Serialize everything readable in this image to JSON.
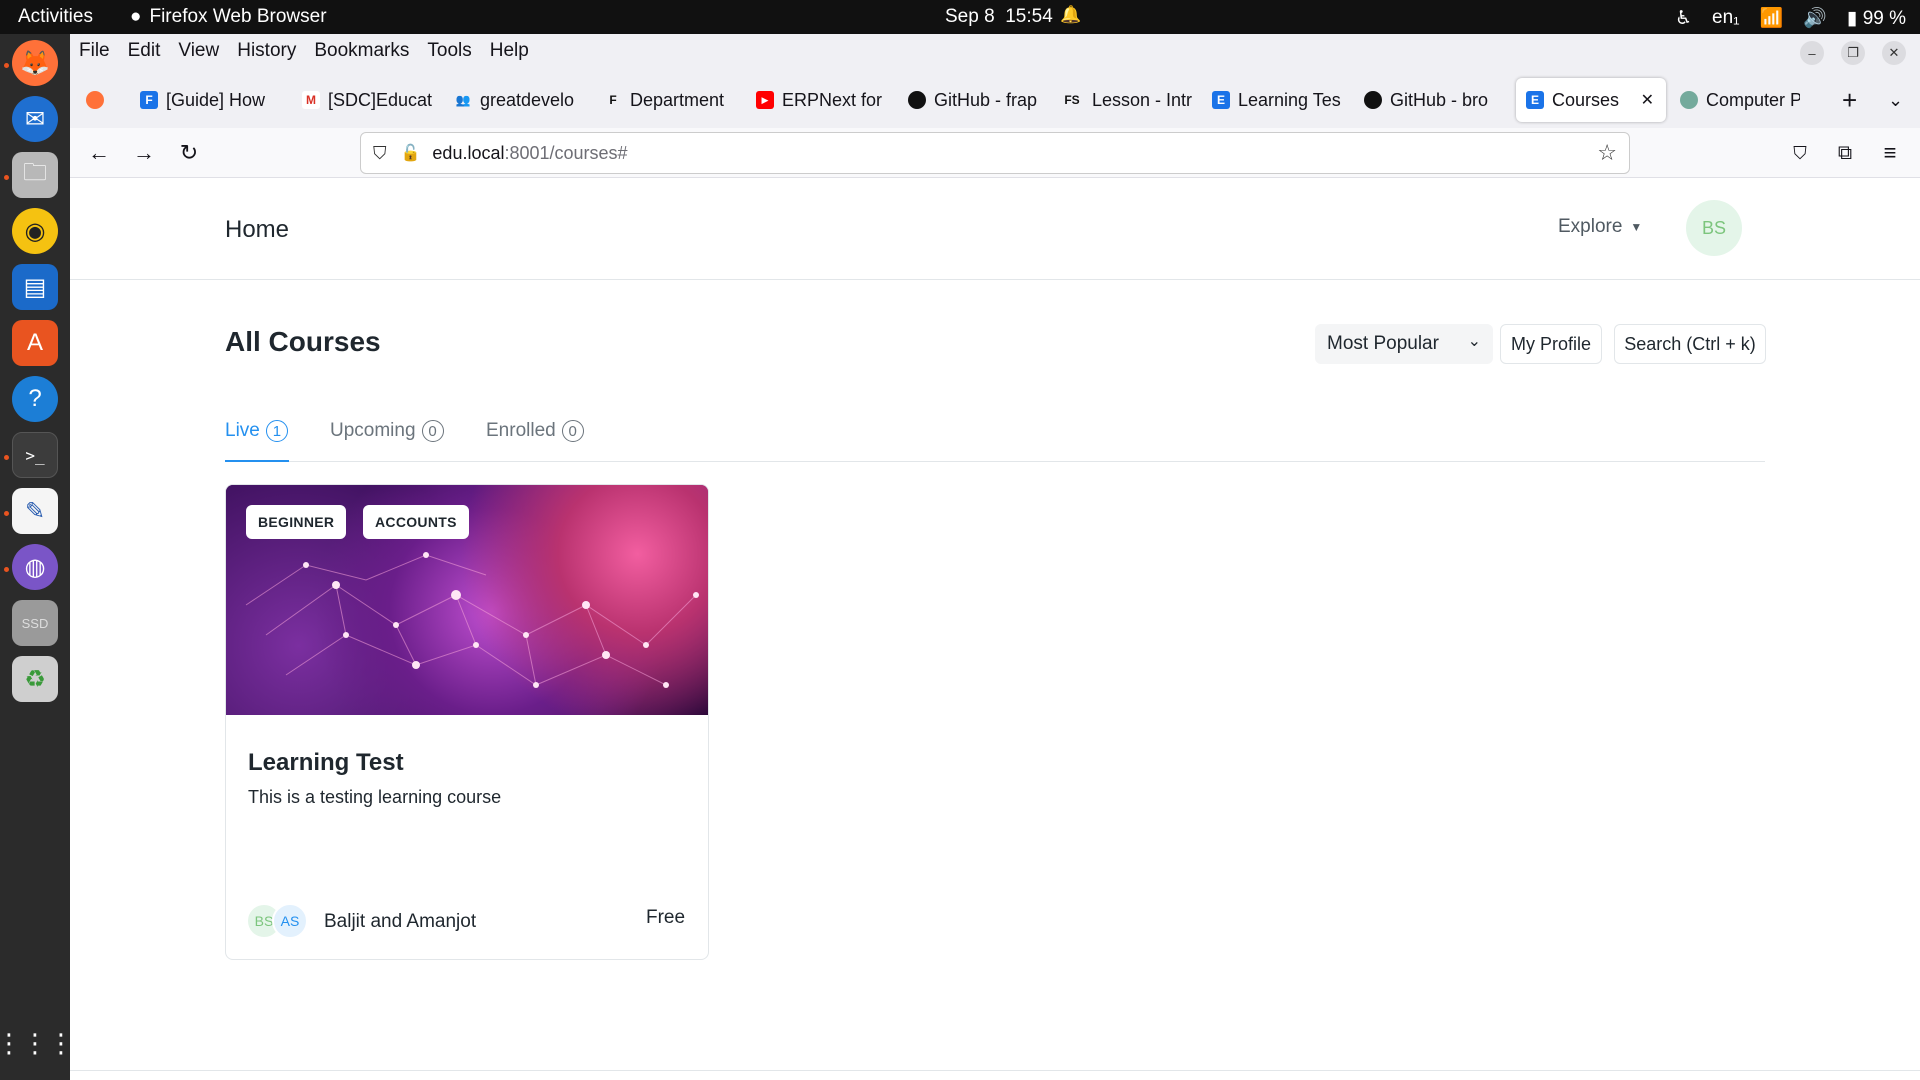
{
  "system_bar": {
    "activities": "Activities",
    "app_name": "Firefox Web Browser",
    "date": "Sep 8",
    "time": "15:54",
    "keyboard": "en₁",
    "battery": "99 %"
  },
  "menu": [
    "File",
    "Edit",
    "View",
    "History",
    "Bookmarks",
    "Tools",
    "Help"
  ],
  "tabs": [
    {
      "label": "[Guide] How",
      "favicon": "F",
      "color": "#1a73e8"
    },
    {
      "label": "[SDC]Educat",
      "favicon": "M",
      "color": "#d93025"
    },
    {
      "label": "greatdevelo",
      "favicon": "👥",
      "color": "#5f63d6"
    },
    {
      "label": "Department",
      "favicon": "F",
      "color": "#111111"
    },
    {
      "label": "ERPNext for",
      "favicon": "▶",
      "color": "#ff0000"
    },
    {
      "label": "GitHub - frap",
      "favicon": "●",
      "color": "#111111"
    },
    {
      "label": "Lesson - Intr",
      "favicon": "FS",
      "color": "#111111"
    },
    {
      "label": "Learning Tes",
      "favicon": "E",
      "color": "#1a73e8"
    },
    {
      "label": "GitHub - bro",
      "favicon": "●",
      "color": "#111111"
    },
    {
      "label": "Courses",
      "favicon": "E",
      "color": "#1a73e8",
      "active": true
    },
    {
      "label": "Computer P",
      "favicon": "◎",
      "color": "#74aa9c"
    }
  ],
  "address": {
    "host": "edu.local",
    "path": ":8001/courses#"
  },
  "site": {
    "home": "Home",
    "explore": "Explore",
    "user_initials": "BS"
  },
  "courses_page": {
    "heading": "All Courses",
    "sort_value": "Most Popular",
    "my_profile": "My Profile",
    "search": "Search (Ctrl + k)",
    "tabs": [
      {
        "label": "Live",
        "count": "1",
        "active": true
      },
      {
        "label": "Upcoming",
        "count": "0"
      },
      {
        "label": "Enrolled",
        "count": "0"
      }
    ]
  },
  "course_card": {
    "tags": [
      "BEGINNER",
      "ACCOUNTS"
    ],
    "title": "Learning Test",
    "description": "This is a testing learning course",
    "instructor_initials": [
      "BS",
      "AS"
    ],
    "instructors": "Baljit and Amanjot",
    "price": "Free"
  },
  "dock_apps": [
    "firefox-icon",
    "thunderbird-icon",
    "files-icon",
    "rhythmbox-icon",
    "writer-icon",
    "app-center-icon",
    "help-icon",
    "terminal-icon",
    "text-editor-icon",
    "network-icon",
    "ssd-drive-icon",
    "trash-icon",
    "show-apps-icon"
  ]
}
